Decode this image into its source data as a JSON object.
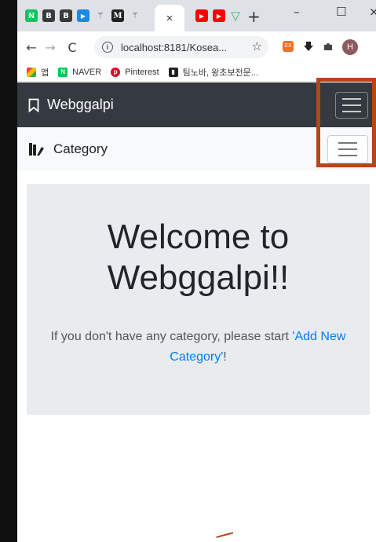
{
  "browser": {
    "tabs": [
      {
        "label": "N",
        "color": "#03c75a"
      },
      {
        "label": "B",
        "color": "#3a3a3a"
      },
      {
        "label": "B",
        "color": "#3a3a3a"
      },
      {
        "label": "▶",
        "color": "#1e88e5"
      },
      {
        "label": "⚚",
        "color": "transparent"
      },
      {
        "label": "M",
        "color": "#222222"
      },
      {
        "label": "⚚",
        "color": "transparent"
      }
    ],
    "active_tab_close": "×",
    "after_tabs": [
      {
        "label": "▶",
        "color": "#ff0000"
      },
      {
        "label": "▶",
        "color": "#ff0000"
      },
      {
        "label": "▽",
        "color": "transparent"
      }
    ],
    "new_tab": "+",
    "window_controls": {
      "minimize": "–",
      "maximize": "☐",
      "close": "×"
    },
    "url": "localhost:8181/Kosea...",
    "profile_initial": "H",
    "bookmarks": [
      {
        "label": "앱",
        "icon": "apps-icon"
      },
      {
        "label": "NAVER",
        "icon": "naver-icon"
      },
      {
        "label": "Pinterest",
        "icon": "pinterest-icon"
      },
      {
        "label": "팀노바, 왕초보전문...",
        "icon": "teamnova-icon"
      }
    ]
  },
  "app": {
    "brand": "Webggalpi",
    "category_label": "Category",
    "welcome_title": "Welcome to Webggalpi!!",
    "welcome_text_before": "If you don't have any category, please start ",
    "welcome_link": "'Add New Category'",
    "welcome_text_after": "!"
  },
  "colors": {
    "navbar_dark": "#343a40",
    "highlight": "#b5451b",
    "link": "#007bff",
    "jumbotron": "#e9ecef"
  }
}
